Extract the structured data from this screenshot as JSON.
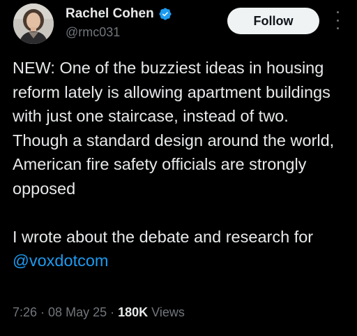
{
  "author": {
    "display_name": "Rachel Cohen",
    "handle": "@rmc031",
    "verified_icon": "verified-badge-icon",
    "avatar_icon": "profile-photo"
  },
  "actions": {
    "follow_label": "Follow",
    "more_icon": "more-vertical-icon"
  },
  "tweet": {
    "paragraph1": "NEW: One of the buzziest ideas in housing reform lately is allowing apartment buildings with just one staircase, instead of two. Though a standard design around the world, American fire safety officials are strongly opposed",
    "paragraph2_prefix": "I wrote about the debate and research for ",
    "mention": "@voxdotcom"
  },
  "meta": {
    "time": "7:26",
    "separator1": " · ",
    "date": "08 May 25",
    "separator2": " · ",
    "views_count": "180K",
    "views_label": " Views"
  },
  "colors": {
    "background": "#000000",
    "text": "#e7e9ea",
    "secondary": "#71767b",
    "link": "#1d9bf0",
    "verified": "#1d9bf0",
    "button_bg": "#eff3f4"
  }
}
